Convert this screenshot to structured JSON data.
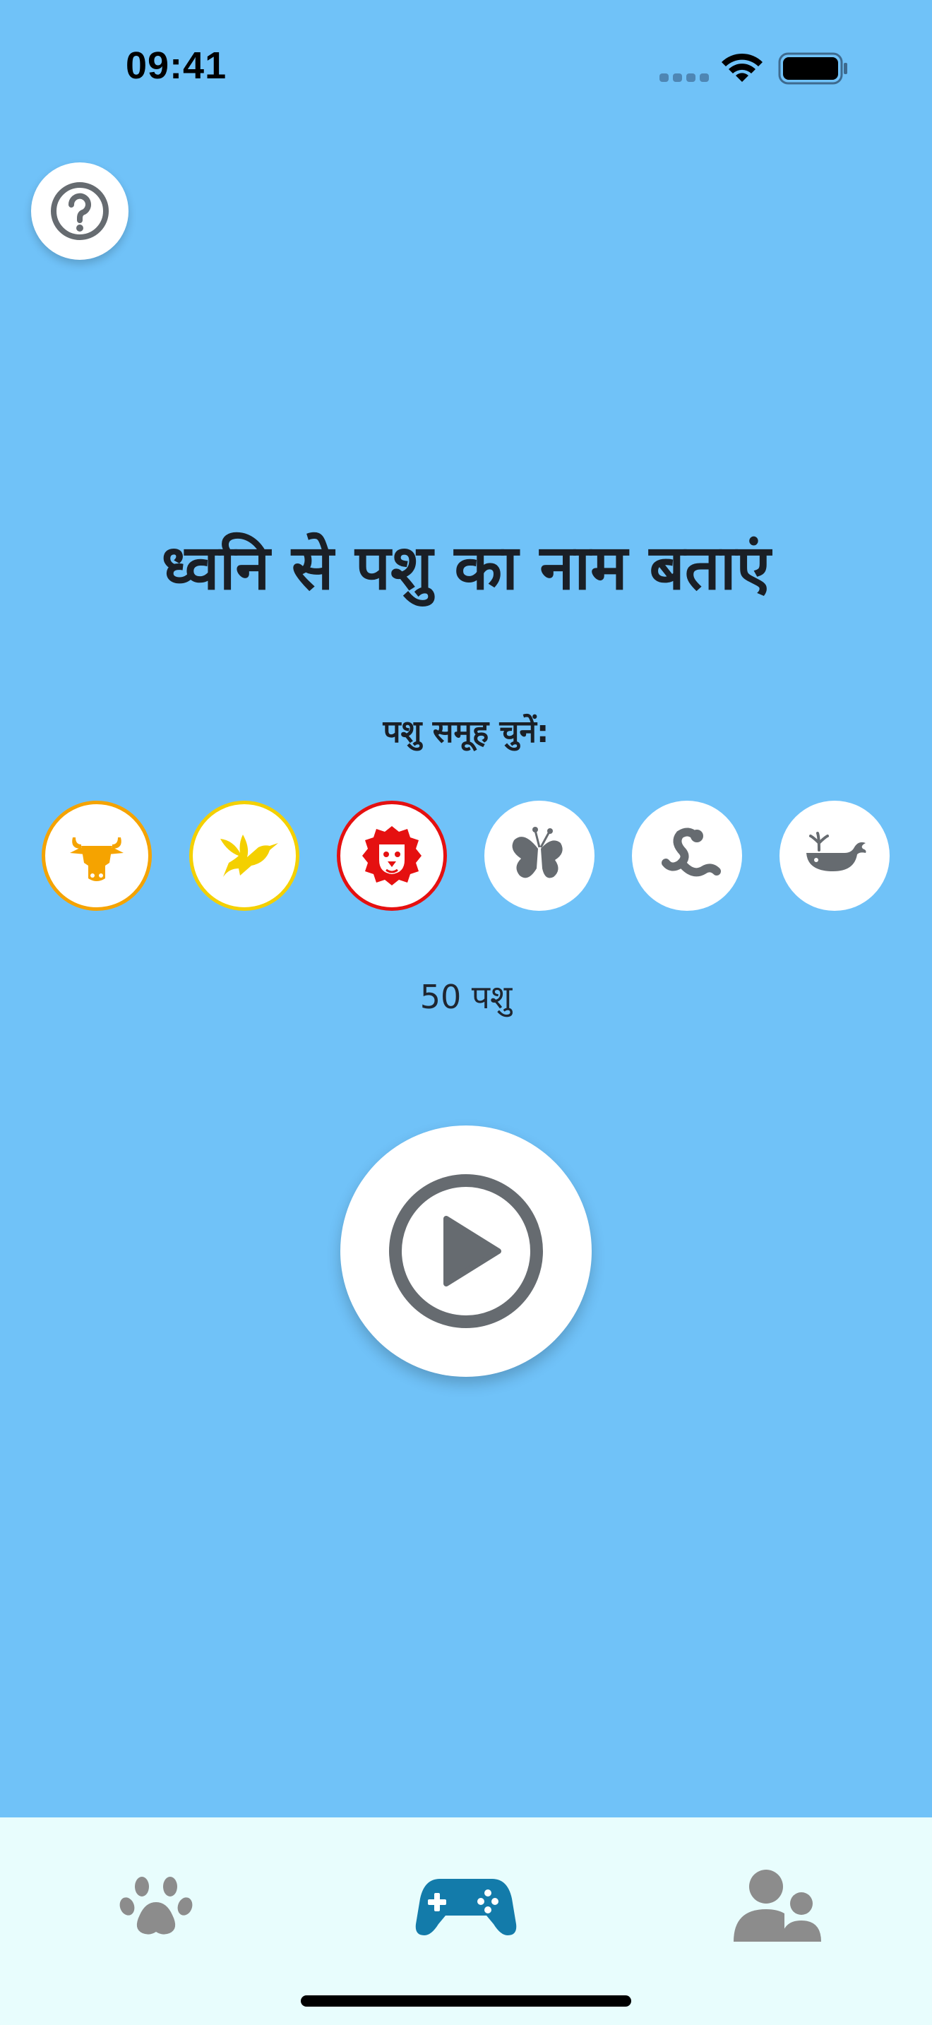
{
  "status_bar": {
    "time": "09:41"
  },
  "help": {
    "icon": "question-circle-icon"
  },
  "main": {
    "title": "ध्वनि से पशु का नाम बताएं",
    "group_label": "पशु समूह चुनें:",
    "count_label": "50 पशु"
  },
  "groups": [
    {
      "name": "farm-animals",
      "icon": "cow-icon",
      "selected": true,
      "color": "#F5A300"
    },
    {
      "name": "birds",
      "icon": "bird-icon",
      "selected": true,
      "color": "#F4D000"
    },
    {
      "name": "wild-animals",
      "icon": "lion-icon",
      "selected": true,
      "color": "#E51010"
    },
    {
      "name": "insects",
      "icon": "butterfly-icon",
      "selected": false,
      "color": "#666B70"
    },
    {
      "name": "reptiles",
      "icon": "snake-icon",
      "selected": false,
      "color": "#666B70"
    },
    {
      "name": "sea-animals",
      "icon": "whale-icon",
      "selected": false,
      "color": "#666B70"
    }
  ],
  "play": {
    "icon": "play-circle-icon",
    "color": "#666B70"
  },
  "tabs": [
    {
      "name": "animals",
      "icon": "paw-icon",
      "active": false,
      "color": "#8C8C8C"
    },
    {
      "name": "games",
      "icon": "gamepad-icon",
      "active": true,
      "color": "#137BAA"
    },
    {
      "name": "profile",
      "icon": "users-icon",
      "active": false,
      "color": "#8C8C8C"
    }
  ],
  "colors": {
    "background": "#70C2F8",
    "tab_bar": "#E8FDFD",
    "text": "#1A1F26"
  }
}
